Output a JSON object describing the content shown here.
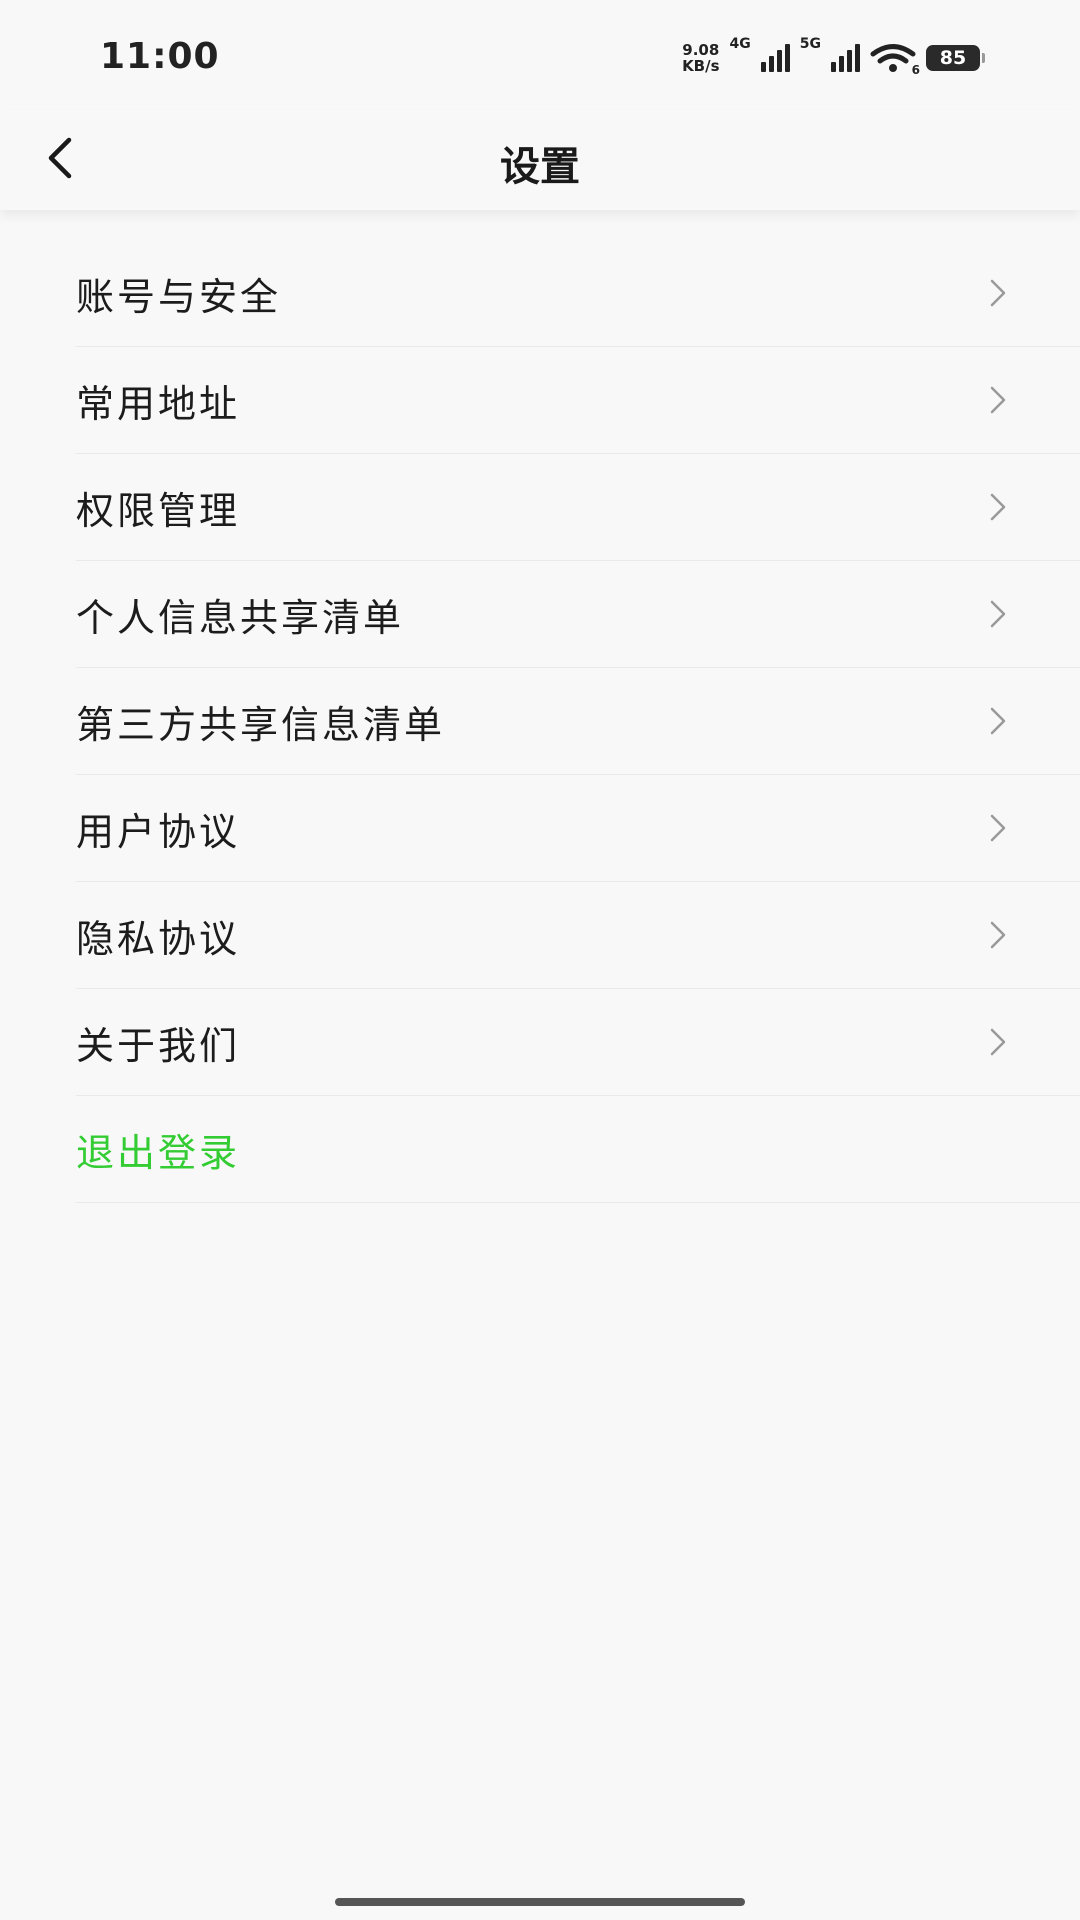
{
  "status_bar": {
    "time": "11:00",
    "net_speed_value": "9.08",
    "net_speed_unit": "KB/s",
    "network_4g": "4G",
    "network_5g": "5G",
    "wifi_sub": "6",
    "battery": "85",
    "icons": [
      "signal-4g-icon",
      "signal-5g-icon",
      "wifi-icon",
      "battery-icon"
    ]
  },
  "header": {
    "title": "设置",
    "back_icon": "chevron-left-icon"
  },
  "menu": {
    "items": [
      {
        "label": "账号与安全"
      },
      {
        "label": "常用地址"
      },
      {
        "label": "权限管理"
      },
      {
        "label": "个人信息共享清单"
      },
      {
        "label": "第三方共享信息清单"
      },
      {
        "label": "用户协议"
      },
      {
        "label": "隐私协议"
      },
      {
        "label": "关于我们"
      }
    ],
    "logout_label": "退出登录",
    "chevron_icon": "chevron-right-icon"
  },
  "colors": {
    "logout": "#33cc33",
    "background": "#f8f8f8",
    "divider": "#e9e9e9"
  }
}
